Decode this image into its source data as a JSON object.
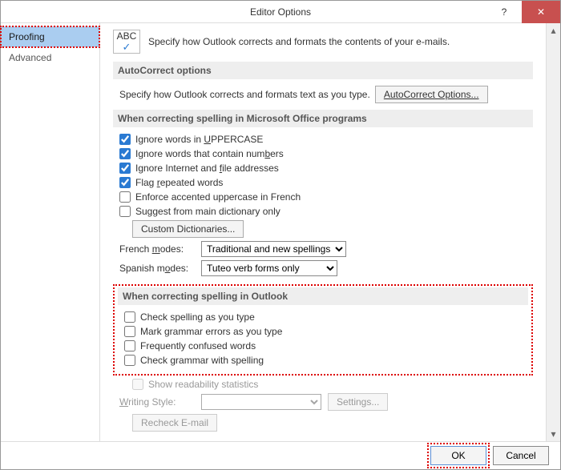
{
  "window": {
    "title": "Editor Options"
  },
  "titlebar": {
    "help_glyph": "?",
    "close_glyph": "✕"
  },
  "sidebar": {
    "items": [
      {
        "label": "Proofing",
        "selected": true
      },
      {
        "label": "Advanced",
        "selected": false
      }
    ]
  },
  "intro": {
    "icon_text": "ABC",
    "icon_check": "✓",
    "text": "Specify how Outlook corrects and formats the contents of your e-mails."
  },
  "sections": {
    "autocorrect": {
      "heading": "AutoCorrect options",
      "text_before": "Specify how Outlook corrects and formats text as you type.",
      "button": "AutoCorrect Options..."
    },
    "office": {
      "heading": "When correcting spelling in Microsoft Office programs",
      "checks": [
        {
          "pre": "Ignore words in ",
          "u": "U",
          "post": "PPERCASE",
          "checked": true
        },
        {
          "pre": "Ignore words that contain num",
          "u": "b",
          "post": "ers",
          "checked": true
        },
        {
          "pre": "Ignore Internet and ",
          "u": "f",
          "post": "ile addresses",
          "checked": true
        },
        {
          "pre": "Flag ",
          "u": "r",
          "post": "epeated words",
          "checked": true
        },
        {
          "pre": "Enforce accented uppercase in French",
          "u": "",
          "post": "",
          "checked": false
        },
        {
          "pre": "Suggest from main dictionary only",
          "u": "",
          "post": "",
          "checked": false
        }
      ],
      "custom_dict_btn": "Custom Dictionaries...",
      "french_label_pre": "French ",
      "french_label_u": "m",
      "french_label_post": "odes:",
      "french_value": "Traditional and new spellings",
      "spanish_label_pre": "Spanish m",
      "spanish_label_u": "o",
      "spanish_label_post": "des:",
      "spanish_value": "Tuteo verb forms only"
    },
    "outlook": {
      "heading": "When correcting spelling in Outlook",
      "checks": [
        {
          "label": "Check spelling as you type",
          "checked": false
        },
        {
          "label": "Mark grammar errors as you type",
          "checked": false
        },
        {
          "label": "Frequently confused words",
          "checked": false
        },
        {
          "label": "Check grammar with spelling",
          "checked": false
        }
      ],
      "readability": "Show readability statistics",
      "writing_style_pre": "",
      "writing_style_u": "W",
      "writing_style_post": "riting Style:",
      "settings_btn": "Settings...",
      "recheck_btn": "Recheck E-mail"
    }
  },
  "footer": {
    "ok": "OK",
    "cancel": "Cancel"
  },
  "scroll": {
    "up": "▴",
    "dn": "▾"
  }
}
